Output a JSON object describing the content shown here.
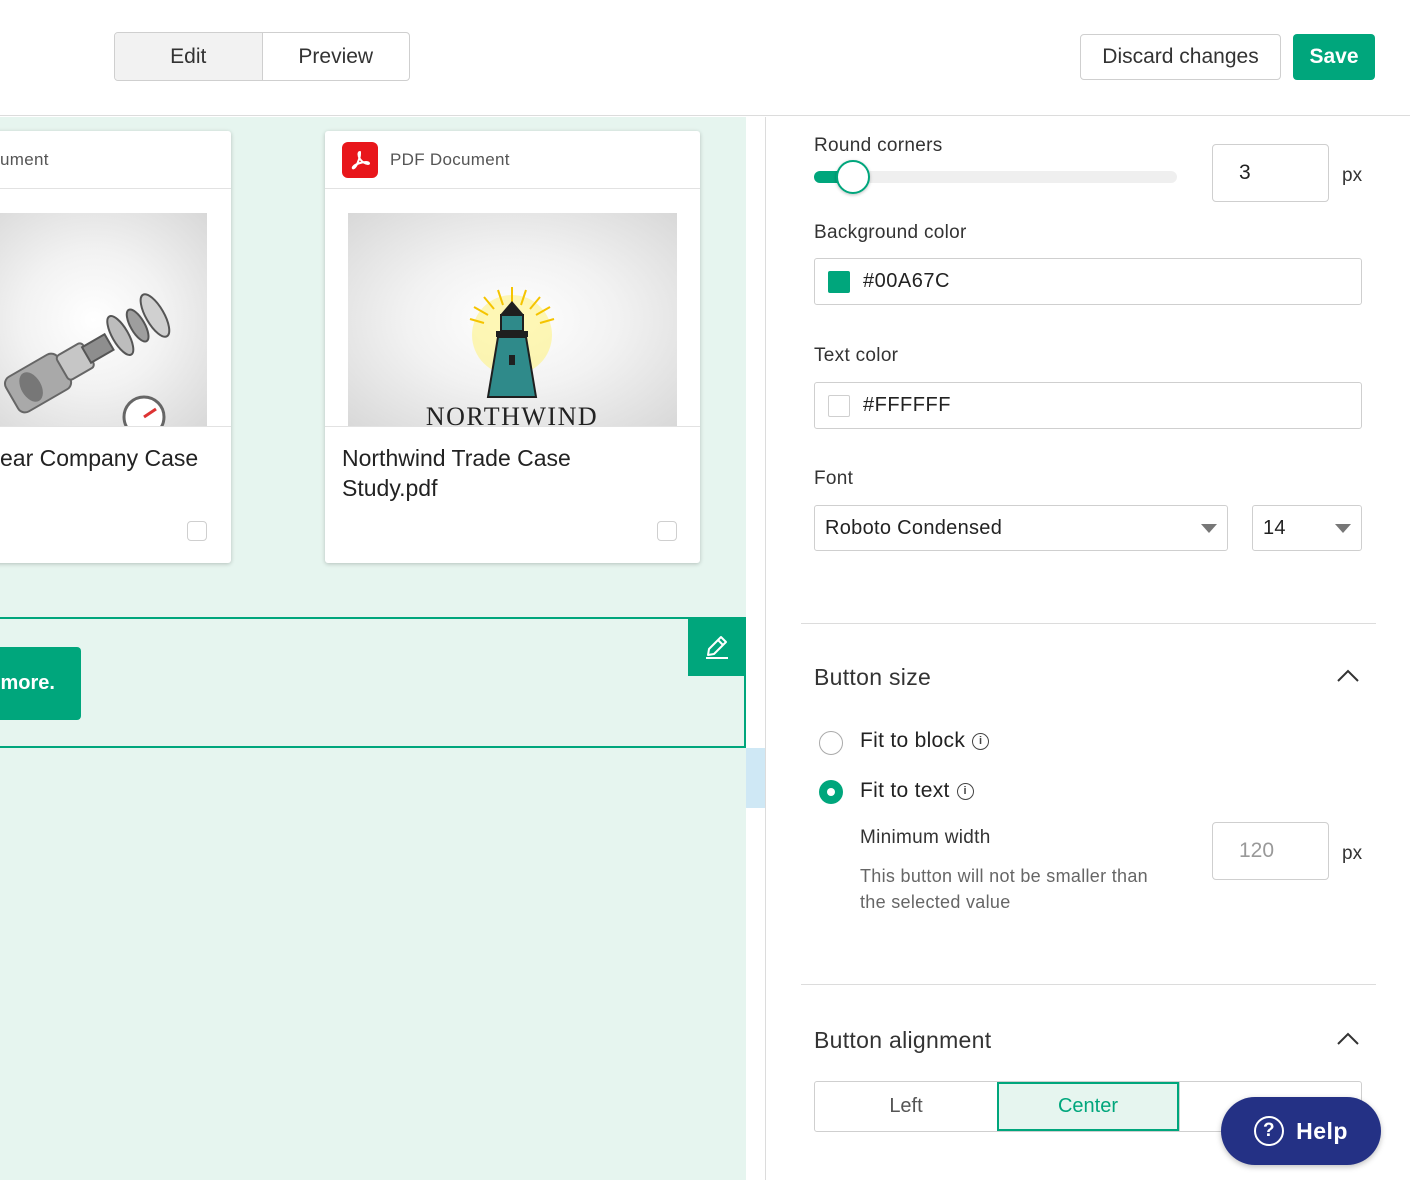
{
  "toolbar": {
    "tabs": [
      "Edit",
      "Preview"
    ],
    "discard_label": "Discard changes",
    "save_label": "Save"
  },
  "canvas": {
    "cards": [
      {
        "type": "ument",
        "title": "ear Company Case"
      },
      {
        "type": "PDF Document",
        "title_line1": "Northwind Trade Case",
        "title_line2": "Study.pdf",
        "logo_text": "NORTHWIND"
      }
    ],
    "cta_label": "r more."
  },
  "panel": {
    "round_corners": {
      "label": "Round corners",
      "value": "3",
      "unit": "px",
      "level": 0.06
    },
    "background_color": {
      "label": "Background color",
      "value": "#00A67C",
      "swatch": "#00a67c"
    },
    "text_color": {
      "label": "Text color",
      "value": "#FFFFFF",
      "swatch": "#ffffff"
    },
    "font": {
      "label": "Font",
      "family": "Roboto Condensed",
      "size": "14"
    },
    "button_size": {
      "title": "Button size",
      "options": [
        {
          "label": "Fit to block",
          "checked": false
        },
        {
          "label": "Fit to text",
          "checked": true
        }
      ],
      "min_width_label": "Minimum width",
      "min_width_placeholder": "120",
      "min_width_unit": "px",
      "hint_line1": "This button will not be smaller than",
      "hint_line2": "the selected value"
    },
    "button_alignment": {
      "title": "Button alignment",
      "options": [
        "Left",
        "Center"
      ]
    }
  },
  "help_label": "Help",
  "colors": {
    "accent": "#00a67c",
    "help": "#243185",
    "canvas_bg": "#e6f5ef",
    "pdf": "#e8161b"
  }
}
